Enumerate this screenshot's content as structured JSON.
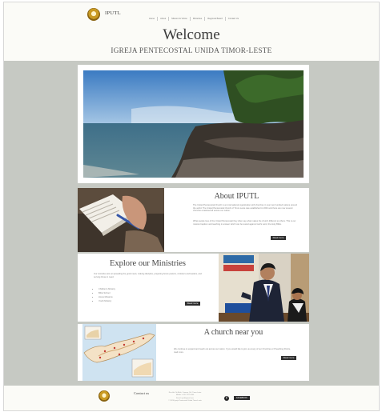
{
  "header": {
    "brand": "IPUTL",
    "nav": [
      "Home",
      "About",
      "Mission & Vision",
      "Ministries",
      "Regional Board",
      "Contact Us"
    ],
    "title": "Welcome",
    "subtitle": "IGREJA PENTECOSTAL UNIDA TIMOR-LESTE"
  },
  "about": {
    "title": "About IPUTL",
    "p1": "The United Pentecostal Church is an international organization with churches in over two hundred nations around the world. The United Pentecostal Church of Timor-Leste was established in 2004 and there are now several churches scattered all across our nation.",
    "p2": "What people love of the United Pentecostal they often say what makes the church different to others. This is our mission baptism and teaching in answer which can be tested against God's word, the Holy Bible.",
    "button": "Read more"
  },
  "ministries": {
    "title": "Explore our Ministries",
    "intro": "Our ministries aim at spreading the good news, making disciples, preparing future pastors, ministers and leaders, and serving those in need.",
    "items": [
      "Children's Ministry",
      "Bible School",
      "Home Missions",
      "Youth Ministry"
    ],
    "button": "Read more"
  },
  "church": {
    "title": "A church near you",
    "text": "We continue to expand and reach out across our nation. If you would like to join us at any of our Churches or Preaching Points, read more.",
    "button": "Read more"
  },
  "footer": {
    "contact": "Contact us",
    "info": [
      "Rua Ho Chi Minh, Comoro, Dili, Timor-Leste",
      "Mobile: +670 7707 0000",
      "Email: iputl@gmail.com",
      "© 2024 Igreja Pentecostal Unida Timor-Leste"
    ],
    "facebook": "f",
    "button": "FACEBOOK"
  },
  "colors": {
    "background": "#c6c9c3",
    "card": "#ffffff",
    "button": "#2d2d2d"
  }
}
